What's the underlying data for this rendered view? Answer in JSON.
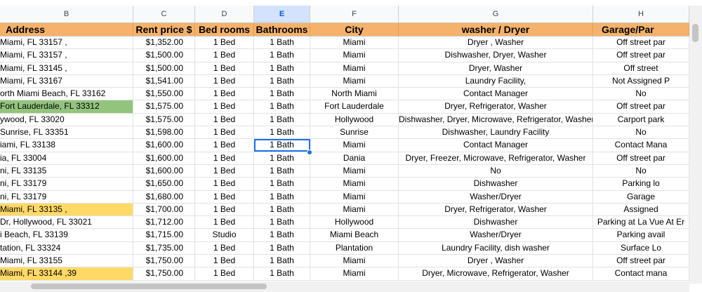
{
  "column_letters": [
    "B",
    "C",
    "D",
    "E",
    "F",
    "G",
    "H"
  ],
  "selected_column": "E",
  "headers": {
    "address": "Address",
    "rent": "Rent price $",
    "bedrooms": "Bed rooms",
    "bathrooms": "Bathrooms",
    "city": "City",
    "washer": "washer / Dryer",
    "garage": "Garage/Par"
  },
  "rows": [
    {
      "address": ", Miami, FL 33157",
      "rent": "$1,352.00",
      "bed": "1  Bed",
      "bath": "1 Bath",
      "city": "Miami",
      "washer": "Dryer , Washer",
      "garage": "Off street par",
      "hl": ""
    },
    {
      "address": ", Miami, FL 33157",
      "rent": "$1,500.00",
      "bed": "1  Bed",
      "bath": "1 Bath",
      "city": "Miami",
      "washer": "Dishwasher, Dryer, Washer",
      "garage": "Off street par",
      "hl": ""
    },
    {
      "address": ", Miami, FL 33145",
      "rent": "$1,500.00",
      "bed": "1  Bed",
      "bath": "1 Bath",
      "city": "Miami",
      "washer": "Dryer, Washer",
      "garage": "Off street",
      "hl": ""
    },
    {
      "address": "Miami, FL 33167",
      "rent": "$1,541.00",
      "bed": "1  Bed",
      "bath": "1 Bath",
      "city": "Miami",
      "washer": "Laundry Facility,",
      "garage": "Not Assigned P",
      "hl": ""
    },
    {
      "address": "orth Miami Beach, FL 33162",
      "rent": "$1,550.00",
      "bed": "1  Bed",
      "bath": "1 Bath",
      "city": "North Miami",
      "washer": "Contact Manager",
      "garage": "No",
      "hl": ""
    },
    {
      "address": "Fort Lauderdale, FL 33312",
      "rent": "$1,575.00",
      "bed": "1  Bed",
      "bath": "1 Bath",
      "city": "Fort Lauderdale",
      "washer": "Dryer, Refrigerator, Washer",
      "garage": "Off street par",
      "hl": "green"
    },
    {
      "address": "ywood, FL 33020",
      "rent": "$1,575.00",
      "bed": "1  Bed",
      "bath": "1 Bath",
      "city": "Hollywood",
      "washer": "Dishwasher, Dryer, Microwave, Refrigerator, Washer",
      "garage": "Carport park",
      "hl": ""
    },
    {
      "address": "Sunrise, FL 33351",
      "rent": "$1,598.00",
      "bed": "1  Bed",
      "bath": "1 Bath",
      "city": "Sunrise",
      "washer": "Dishwasher, Laundry Facility",
      "garage": "No",
      "hl": ""
    },
    {
      "address": "iami, FL 33138",
      "rent": "$1,600.00",
      "bed": "1  Bed",
      "bath": "1 Bath",
      "city": "Miami",
      "washer": "Contact Manager",
      "garage": "Contact Mana",
      "hl": ""
    },
    {
      "address": "ia, FL 33004",
      "rent": "$1,600.00",
      "bed": "1  Bed",
      "bath": "1 Bath",
      "city": "Dania",
      "washer": "Dryer, Freezer, Microwave, Refrigerator, Washer",
      "garage": "Off street par",
      "hl": ""
    },
    {
      "address": "ni, FL 33135",
      "rent": "$1,600.00",
      "bed": "1  Bed",
      "bath": "1 Bath",
      "city": "Miami",
      "washer": "No",
      "garage": "No",
      "hl": ""
    },
    {
      "address": "ni, FL 33179",
      "rent": "$1,650.00",
      "bed": "1  Bed",
      "bath": "1 Bath",
      "city": "Miami",
      "washer": "Dishwasher",
      "garage": "Parking lo",
      "hl": ""
    },
    {
      "address": "ni, FL 33179",
      "rent": "$1,680.00",
      "bed": "1  Bed",
      "bath": "1 Bath",
      "city": "Miami",
      "washer": "Washer/Dryer",
      "garage": "Garage",
      "hl": ""
    },
    {
      "address": ", Miami, FL 33135",
      "rent": "$1,700.00",
      "bed": "1  Bed",
      "bath": "1 Bath",
      "city": "Miami",
      "washer": "Dryer, Refrigerator, Washer",
      "garage": "Assigned",
      "hl": "yellow"
    },
    {
      "address": "Dr, Hollywood, FL 33021",
      "rent": "$1,712.00",
      "bed": "1  Bed",
      "bath": "1 Bath",
      "city": "Hollywood",
      "washer": "Dishwasher",
      "garage": "Parking at La Vue At Er",
      "hl": ""
    },
    {
      "address": "i Beach, FL 33139",
      "rent": "$1,715.00",
      "bed": "Studio",
      "bath": "1 Bath",
      "city": "Miami Beach",
      "washer": "Washer/Dryer",
      "garage": "Parking avail",
      "hl": ""
    },
    {
      "address": "tation, FL 33324",
      "rent": "$1,735.00",
      "bed": "1  Bed",
      "bath": "1 Bath",
      "city": "Plantation",
      "washer": "Laundry Facility, dish washer",
      "garage": "Surface Lo",
      "hl": ""
    },
    {
      "address": "Miami, FL 33155",
      "rent": "$1,750.00",
      "bed": "1  Bed",
      "bath": "1 Bath",
      "city": "Miami",
      "washer": "Dryer , Washer",
      "garage": "Off street par",
      "hl": ""
    },
    {
      "address": "39, Miami, FL 33144",
      "rent": "$1,750.00",
      "bed": "1  Bed",
      "bath": "1 Bath",
      "city": "Miami",
      "washer": "Dryer, Microwave, Refrigerator, Washer",
      "garage": "Contact mana",
      "hl": "yellow"
    }
  ],
  "selected_cell": {
    "row": 8,
    "column": "E"
  },
  "colors": {
    "header_fill": "#f6b26b",
    "green_fill": "#93c47d",
    "yellow_fill": "#ffd966",
    "selection": "#1a73e8"
  }
}
